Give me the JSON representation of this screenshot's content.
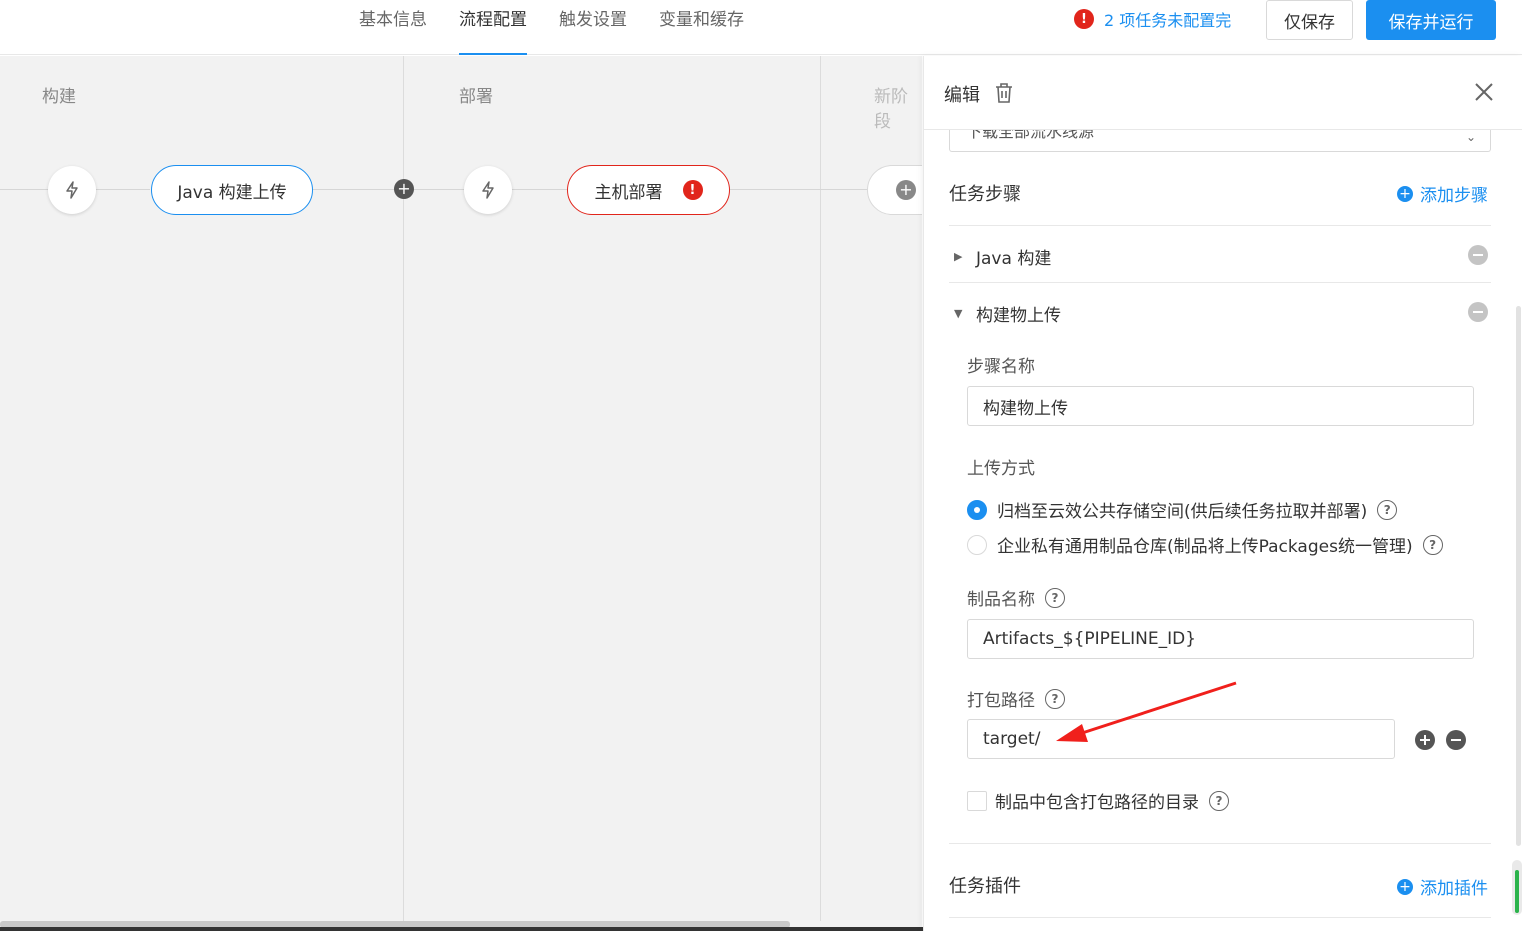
{
  "header": {
    "tabs": [
      {
        "label": "基本信息",
        "active": false
      },
      {
        "label": "流程配置",
        "active": true
      },
      {
        "label": "触发设置",
        "active": false
      },
      {
        "label": "变量和缓存",
        "active": false
      }
    ],
    "warning_text": "2 项任务未配置完",
    "save_only_label": "仅保存",
    "save_run_label": "保存并运行"
  },
  "pipeline": {
    "stages": [
      {
        "title": "构建",
        "task": "Java 构建上传",
        "status": "ok"
      },
      {
        "title": "部署",
        "task": "主机部署",
        "status": "error"
      },
      {
        "title": "新阶段"
      }
    ]
  },
  "panel": {
    "title": "编辑",
    "source_select_value": "下载全部流水线源",
    "task_steps_title": "任务步骤",
    "add_step_label": "添加步骤",
    "steps": [
      {
        "name": "Java 构建",
        "expanded": false
      },
      {
        "name": "构建物上传",
        "expanded": true
      }
    ],
    "step_name_label": "步骤名称",
    "step_name_value": "构建物上传",
    "upload_method_label": "上传方式",
    "upload_options": [
      {
        "label": "归档至云效公共存储空间(供后续任务拉取并部署)",
        "checked": true
      },
      {
        "label": "企业私有通用制品仓库(制品将上传Packages统一管理)",
        "checked": false
      }
    ],
    "artifact_name_label": "制品名称",
    "artifact_name_value": "Artifacts_${PIPELINE_ID}",
    "package_path_label": "打包路径",
    "package_path_value": "target/",
    "include_dir_label": "制品中包含打包路径的目录",
    "include_dir_checked": false,
    "task_plugins_title": "任务插件",
    "add_plugin_label": "添加插件"
  },
  "colors": {
    "accent": "#1b8ff0",
    "error": "#e1251b",
    "annotation_arrow": "#f0201c"
  }
}
